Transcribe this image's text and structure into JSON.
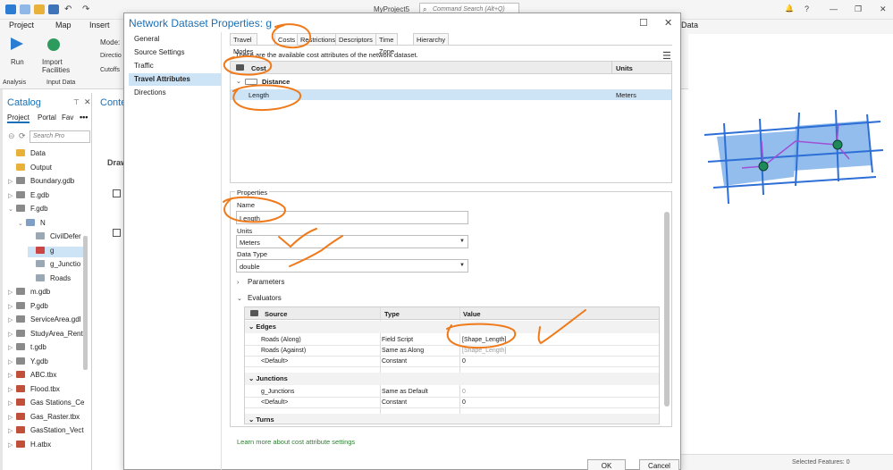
{
  "app": {
    "title": "MyProject5",
    "command_search_placeholder": "Command Search (Alt+Q)",
    "window_controls": [
      "?",
      "—",
      "❐",
      "✕"
    ]
  },
  "ribbon": {
    "tabs": [
      "Project",
      "Map",
      "Insert",
      "Data"
    ],
    "run_label": "Run",
    "import_label": "Import Facilities",
    "mode_label": "Mode:",
    "directions_label": "Directio",
    "cutoffs_label": "Cutoffs",
    "analysis_group": "Analysis",
    "input_data_group": "Input Data"
  },
  "catalog": {
    "title": "Catalog",
    "tabs": [
      "Project",
      "Portal",
      "Fav"
    ],
    "search_placeholder": "Search Pro",
    "items": [
      {
        "label": "Data",
        "kind": "folder",
        "indent": 0
      },
      {
        "label": "Output",
        "kind": "folder",
        "indent": 0
      },
      {
        "label": "Boundary.gdb",
        "kind": "gdb",
        "indent": 0
      },
      {
        "label": "E.gdb",
        "kind": "gdb",
        "indent": 0
      },
      {
        "label": "F.gdb",
        "kind": "gdb",
        "indent": 0
      },
      {
        "label": "N",
        "kind": "dataset",
        "indent": 1
      },
      {
        "label": "CivilDefer",
        "kind": "fc",
        "indent": 2
      },
      {
        "label": "g",
        "kind": "network",
        "indent": 2
      },
      {
        "label": "g_Junctio",
        "kind": "fc",
        "indent": 2
      },
      {
        "label": "Roads",
        "kind": "fc",
        "indent": 2
      },
      {
        "label": "m.gdb",
        "kind": "gdb",
        "indent": 0
      },
      {
        "label": "P.gdb",
        "kind": "gdb",
        "indent": 0
      },
      {
        "label": "ServiceArea.gdl",
        "kind": "gdb",
        "indent": 0
      },
      {
        "label": "StudyArea_Rent",
        "kind": "gdb",
        "indent": 0
      },
      {
        "label": "t.gdb",
        "kind": "gdb",
        "indent": 0
      },
      {
        "label": "Y.gdb",
        "kind": "gdb",
        "indent": 0
      },
      {
        "label": "ABC.tbx",
        "kind": "tbx",
        "indent": 0
      },
      {
        "label": "Flood.tbx",
        "kind": "tbx",
        "indent": 0
      },
      {
        "label": "Gas Stations_Ce",
        "kind": "tbx",
        "indent": 0
      },
      {
        "label": "Gas_Raster.tbx",
        "kind": "tbx",
        "indent": 0
      },
      {
        "label": "GasStation_Vect",
        "kind": "tbx",
        "indent": 0
      },
      {
        "label": "H.atbx",
        "kind": "tbx",
        "indent": 0
      }
    ]
  },
  "contents": {
    "title": "Conte",
    "draw_label": "Draw"
  },
  "status": {
    "selected_features": "Selected Features: 0"
  },
  "dialog": {
    "title": "Network Dataset Properties: g",
    "nav": [
      "General",
      "Source Settings",
      "Traffic",
      "Travel Attributes",
      "Directions"
    ],
    "nav_active": 3,
    "tabs": [
      "Travel Modes",
      "Costs",
      "Restrictions",
      "Descriptors",
      "Time Zone",
      "Hierarchy"
    ],
    "tab_active": 1,
    "description": "These are the available cost attributes of the network dataset.",
    "cost_table": {
      "headers": [
        "Cost",
        "Units"
      ],
      "group": "Distance",
      "row": {
        "name": "Length",
        "units": "Meters"
      }
    },
    "properties": {
      "title": "Properties",
      "name_label": "Name",
      "name_value": "Length",
      "units_label": "Units",
      "units_value": "Meters",
      "datatype_label": "Data Type",
      "datatype_value": "double",
      "parameters_label": "Parameters",
      "evaluators_label": "Evaluators"
    },
    "evaluators": {
      "headers": [
        "Source",
        "Type",
        "Value"
      ],
      "groups": [
        {
          "name": "Edges",
          "rows": [
            {
              "source": "Roads (Along)",
              "type": "Field Script",
              "value": "[Shape_Length]",
              "dim": false
            },
            {
              "source": "Roads (Against)",
              "type": "Same as Along",
              "value": "[Shape_Length]",
              "dim": true
            },
            {
              "source": "<Default>",
              "type": "Constant",
              "value": "0",
              "dim": false
            }
          ]
        },
        {
          "name": "Junctions",
          "rows": [
            {
              "source": "g_Junctions",
              "type": "Same as Default",
              "value": "0",
              "dim": true
            },
            {
              "source": "<Default>",
              "type": "Constant",
              "value": "0",
              "dim": false
            }
          ]
        },
        {
          "name": "Turns",
          "rows": []
        }
      ]
    },
    "learn_link": "Learn more about cost attribute settings",
    "ok_label": "OK",
    "cancel_label": "Cancel"
  },
  "colors": {
    "accent_blue": "#1a6fb6",
    "selection_blue": "#cde3f6",
    "annotation_orange": "#f07a1a",
    "map_fill": "#7fb2ea",
    "map_road": "#2d6fd6",
    "map_node": "#1e8a5a"
  }
}
